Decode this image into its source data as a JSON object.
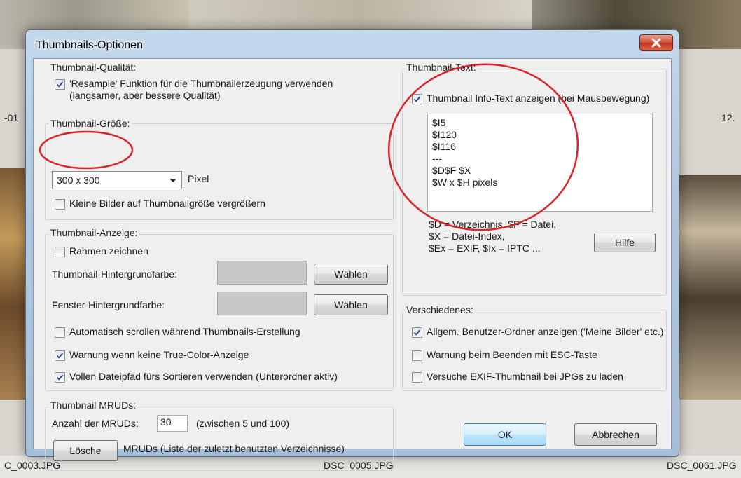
{
  "background": {
    "file_labels": [
      "C_0003.JPG",
      "DSC_0005.JPG",
      "DSC_0061.JPG"
    ],
    "partial_labels": [
      "-01",
      "12."
    ]
  },
  "dialog": {
    "title": "Thumbnails-Optionen",
    "close_icon": "close-icon"
  },
  "quality": {
    "title": "Thumbnail-Qualität:",
    "resample": {
      "label": "'Resample' Funktion für die Thumbnailerzeugung verwenden (langsamer, aber bessere Qualität)",
      "checked": true
    }
  },
  "size": {
    "title": "Thumbnail-Größe:",
    "selected": "300 x 300",
    "unit": "Pixel",
    "enlarge": {
      "label": "Kleine Bilder auf Thumbnailgröße vergrößern",
      "checked": false
    }
  },
  "display": {
    "title": "Thumbnail-Anzeige:",
    "frame": {
      "label": "Rahmen zeichnen",
      "checked": false
    },
    "thumb_bg_label": "Thumbnail-Hintergrundfarbe:",
    "window_bg_label": "Fenster-Hintergrundfarbe:",
    "choose_label": "Wählen",
    "swatch_color": "#c8c8c8",
    "auto_scroll": {
      "label": "Automatisch scrollen während Thumbnails-Erstellung",
      "checked": false
    },
    "warn_truecolor": {
      "label": "Warnung wenn keine True-Color-Anzeige",
      "checked": true
    },
    "full_path": {
      "label": "Vollen Dateipfad fürs Sortieren verwenden (Unterordner aktiv)",
      "checked": true
    }
  },
  "mruds": {
    "title": "Thumbnail MRUDs:",
    "count_label": "Anzahl der MRUDs:",
    "count_value": "30",
    "range_hint": "(zwischen 5 und 100)",
    "delete_label": "Lösche",
    "delete_hint": "MRUDs (Liste der zuletzt benutzten Verzeichnisse)"
  },
  "thumb_text": {
    "title": "Thumbnail-Text:",
    "show_info": {
      "label": "Thumbnail Info-Text anzeigen (bei Mausbewegung)",
      "checked": true
    },
    "lines": [
      "$I5",
      "$I120",
      "$I116",
      "---",
      "$D$F $X",
      "$W x $H pixels"
    ],
    "legend": [
      "$D = Verzeichnis, $F = Datei,",
      "$X = Datei-Index,",
      "$Ex = EXIF, $Ix = IPTC ..."
    ],
    "help_label": "Hilfe"
  },
  "misc": {
    "title": "Verschiedenes:",
    "user_folders": {
      "label": "Allgem. Benutzer-Ordner anzeigen ('Meine Bilder' etc.)",
      "checked": true
    },
    "esc_warning": {
      "label": "Warnung beim Beenden mit ESC-Taste",
      "checked": false
    },
    "exif_thumb": {
      "label": "Versuche EXIF-Thumbnail bei JPGs zu laden",
      "checked": false
    }
  },
  "buttons": {
    "ok": "OK",
    "cancel": "Abbrechen"
  },
  "annotation_color": "#d8252c"
}
